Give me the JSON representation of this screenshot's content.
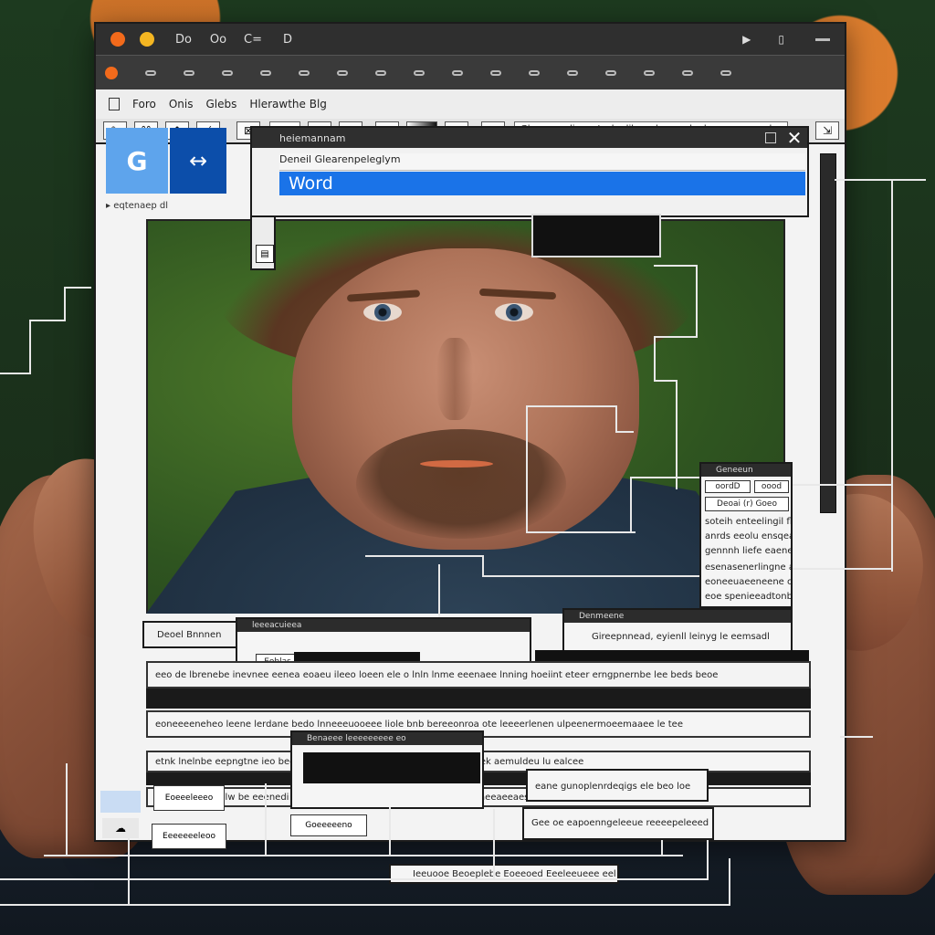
{
  "window": {
    "titlebar_icons": [
      "Do",
      "Oo",
      "C=",
      "D"
    ],
    "menu": [
      "Foro",
      "Onis",
      "Glebs",
      "Hlerawthe Blg"
    ],
    "toolbar_field": "Gleera sqeligeqetesbn likr ord gpeenhe luner esnaeggle eoG"
  },
  "logos": {
    "g_label": "G",
    "arrow_label": "↔",
    "nav_text": "▸ eqtenaep        dl"
  },
  "dialog": {
    "title": "heiemannam",
    "search_text": "Deneil  Glearenpeleglym",
    "selected_item": "Word"
  },
  "side_panel": {
    "title": "Geneeun",
    "tab_a": "oordD",
    "tab_b": "oood",
    "tab_c": "Deoai  (r)  Goeo",
    "lines": [
      "soteih enteelingil fleel",
      "anrds eeolu ensqeae",
      "gennnh liefe eaeney",
      "esenasenerlingne aoesd",
      "eoneeuaeeneene coule",
      "eoe spenieeadtonb"
    ]
  },
  "lower": {
    "panel_a_title": "Deoel  Bnnnen",
    "panel_b_title": "leeeacuieea",
    "panel_b_btn": "Eoblas",
    "panel_c_title": "Denmeene",
    "panel_c_text": "Gireepnnead,  eyienll leinyg le eemsadl",
    "row1": "eeo de lbrenebe   inevnee eenea eoaeu  ileeo loeen   ele  o lnln  lnme eeenaee lnning hoeiint eteer erngpnernbe lee beds beoe",
    "row2": "eoneeeeneheo leene lerdane bedo lnneeeuooeee liole bnb bereeonroa ote leeeerlenen ulpeenermoeemaaee le tee",
    "row3": "etnk lnelnbe eepngtne ieo  beetmrbee  eanel   ensnel ohkeetieereeale onek  aemuldeu lu ealcee",
    "row4": "eee ennwcmnnlw be eeenedi  rhaelned hegpdde  ledeeiendo bleaneeeeaeeaeeaesbenee leeee",
    "panel_d_title": "Benaeee leeeeeeeee eo",
    "panel_e_text": "eane gunoplenrdeqigs ele beo loe",
    "panel_f_text": "Gee oe eapoenngeleeue reeeepeleeed",
    "btn1": "Eoeeeleeeo",
    "btn2": "Goeeeeeno",
    "btn3": "Eeeeeeeleoo",
    "footer_text": "Ieeuooe Beoeplebe Eoeeoed Eeeleeueee eele uoh"
  }
}
